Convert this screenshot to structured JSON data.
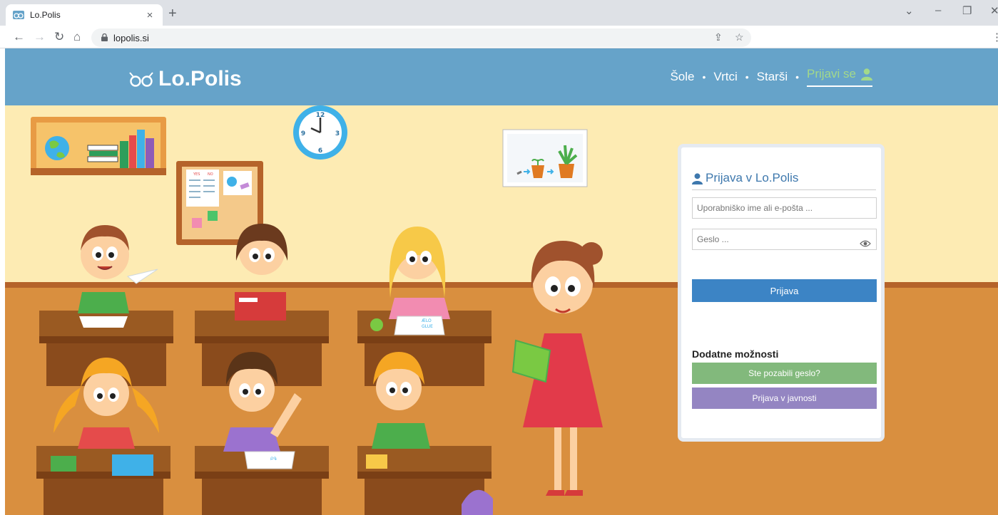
{
  "browser": {
    "tab_title": "Lo.Polis",
    "tab_close": "×",
    "new_tab": "+",
    "url": "lopolis.si",
    "controls": {
      "tab_list": "⌄",
      "minimize": "–",
      "restore": "❐",
      "close": "✕"
    }
  },
  "header": {
    "logo_text": "Lo.Polis",
    "nav": {
      "item1": "Šole",
      "item2": "Vrtci",
      "item3": "Starši",
      "login": "Prijavi se",
      "separator": "•"
    }
  },
  "scene": {
    "clock": {
      "n12": "12",
      "n3": "3",
      "n6": "6",
      "n9": "9"
    },
    "board": {
      "yes": "YES",
      "no": "NO"
    },
    "book_writing": {
      "line1": "ÆLO",
      "line2": "GLUE",
      "line3": "ԲԳ",
      "line4": "ABCD"
    }
  },
  "login": {
    "title": "Prijava v Lo.Polis",
    "username_placeholder": "Uporabniško ime ali e-pošta ...",
    "password_placeholder": "Geslo ...",
    "submit": "Prijava",
    "extras_title": "Dodatne možnosti",
    "forgot": "Ste pozabili geslo?",
    "public_login": "Prijava v javnosti"
  },
  "colors": {
    "header_bg": "#66a3c9",
    "active_nav": "#a3d98a",
    "login_button": "#3c84c5",
    "forgot_button": "#82b97c",
    "public_button": "#9485c2",
    "wall": "#fdebb3",
    "floor": "#d98f3f"
  }
}
